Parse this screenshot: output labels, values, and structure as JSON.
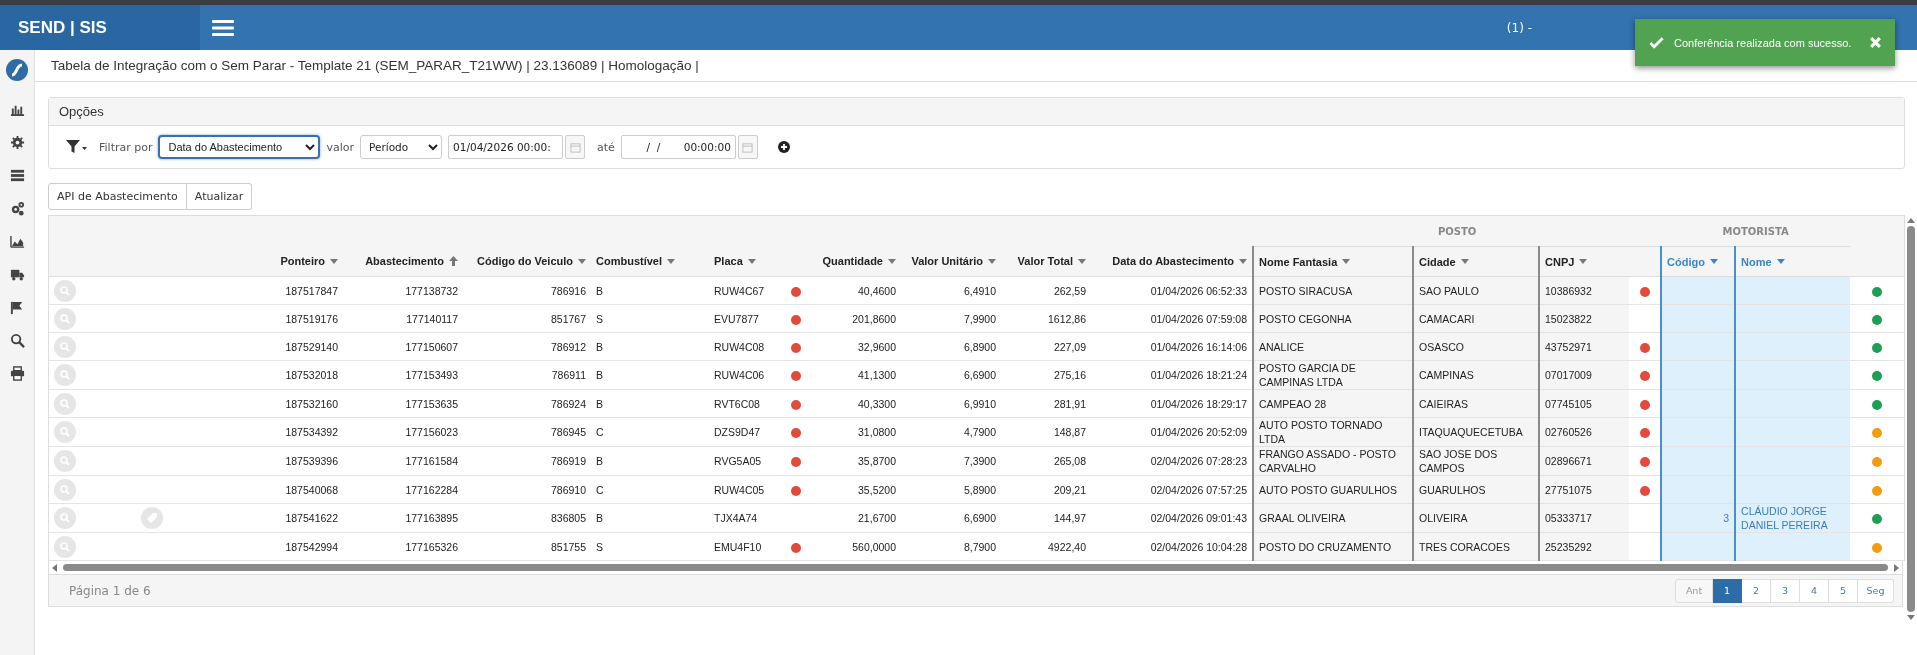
{
  "app": {
    "brand": "SEND | SIS",
    "user_prefix": "(1) -"
  },
  "toast": {
    "message": "Conferência realizada com sucesso."
  },
  "page_title": "Tabela de Integração com o Sem Parar - Template 21 (SEM_PARAR_T21WW) | 23.136089 | Homologação |",
  "options": {
    "title": "Opções",
    "filter_label": "Filtrar por",
    "filter_field": "Data do Abastecimento",
    "value_label": "valor",
    "value_mode": "Período",
    "date_from": "01/04/2026 00:00:",
    "to_label": "até",
    "date_to": " /  /       00:00:00"
  },
  "actions": [
    "API de Abastecimento",
    "Atualizar"
  ],
  "table": {
    "groups": [
      {
        "label": "POSTO"
      },
      {
        "label": "MOTORISTA"
      }
    ],
    "columns": [
      {
        "label": "Ponteiro",
        "sorted": false
      },
      {
        "label": "Abastecimento",
        "sorted": true
      },
      {
        "label": "Código do Veiculo",
        "sorted": false
      },
      {
        "label": "Combustível",
        "sorted": false
      },
      {
        "label": "Placa",
        "sorted": false
      },
      {
        "label": "Quantidade",
        "sorted": false
      },
      {
        "label": "Valor Unitário",
        "sorted": false
      },
      {
        "label": "Valor Total",
        "sorted": false
      },
      {
        "label": "Data do Abastecimento",
        "sorted": false
      },
      {
        "label": "Nome Fantasia",
        "sorted": false
      },
      {
        "label": "Cidade",
        "sorted": false
      },
      {
        "label": "CNPJ",
        "sorted": false
      },
      {
        "label": "Código",
        "sorted": false
      },
      {
        "label": "Nome",
        "sorted": false
      }
    ],
    "rows": [
      {
        "ponteiro": "187517847",
        "abastecimento": "177138732",
        "codigo_veiculo": "786916",
        "combustivel": "B",
        "placa": "RUW4C67",
        "placa_alert": true,
        "quantidade": "40,4600",
        "valor_unitario": "6,4910",
        "valor_total": "262,59",
        "data": "01/04/2026 06:52:33",
        "nome_fantasia": "POSTO SIRACUSA",
        "cidade": "SAO PAULO",
        "cnpj": "10386932",
        "cnpj_alert": true,
        "color": "#1e9e55",
        "has_ticket": false
      },
      {
        "ponteiro": "187519176",
        "abastecimento": "177140117",
        "codigo_veiculo": "851767",
        "combustivel": "S",
        "placa": "EVU7877",
        "placa_alert": true,
        "quantidade": "201,8600",
        "valor_unitario": "7,9900",
        "valor_total": "1612,86",
        "data": "01/04/2026 07:59:08",
        "nome_fantasia": "POSTO CEGONHA",
        "cidade": "CAMACARI",
        "cnpj": "15023822",
        "cnpj_alert": false,
        "color": "#1e9e55",
        "has_ticket": false
      },
      {
        "ponteiro": "187529140",
        "abastecimento": "177150607",
        "codigo_veiculo": "786912",
        "combustivel": "B",
        "placa": "RUW4C08",
        "placa_alert": true,
        "quantidade": "32,9600",
        "valor_unitario": "6,8900",
        "valor_total": "227,09",
        "data": "01/04/2026 16:14:06",
        "nome_fantasia": "ANALICE",
        "cidade": "OSASCO",
        "cnpj": "43752971",
        "cnpj_alert": true,
        "color": "#1e9e55",
        "has_ticket": false
      },
      {
        "ponteiro": "187532018",
        "abastecimento": "177153493",
        "codigo_veiculo": "786911",
        "combustivel": "B",
        "placa": "RUW4C06",
        "placa_alert": true,
        "quantidade": "41,1300",
        "valor_unitario": "6,6900",
        "valor_total": "275,16",
        "data": "01/04/2026 18:21:24",
        "nome_fantasia": "POSTO GARCIA DE CAMPINAS LTDA",
        "cidade": "CAMPINAS",
        "cnpj": "07017009",
        "cnpj_alert": true,
        "color": "#1e9e55",
        "has_ticket": false
      },
      {
        "ponteiro": "187532160",
        "abastecimento": "177153635",
        "codigo_veiculo": "786924",
        "combustivel": "B",
        "placa": "RVT6C08",
        "placa_alert": true,
        "quantidade": "40,3300",
        "valor_unitario": "6,9910",
        "valor_total": "281,91",
        "data": "01/04/2026 18:29:17",
        "nome_fantasia": "CAMPEAO 28",
        "cidade": "CAIEIRAS",
        "cnpj": "07745105",
        "cnpj_alert": true,
        "color": "#1e9e55",
        "has_ticket": false
      },
      {
        "ponteiro": "187534392",
        "abastecimento": "177156023",
        "codigo_veiculo": "786945",
        "combustivel": "C",
        "placa": "DZS9D47",
        "placa_alert": true,
        "quantidade": "31,0800",
        "valor_unitario": "4,7900",
        "valor_total": "148,87",
        "data": "01/04/2026 20:52:09",
        "nome_fantasia": "AUTO POSTO TORNADO LTDA",
        "cidade": "ITAQUAQUECETUBA",
        "cnpj": "02760526",
        "cnpj_alert": true,
        "color": "#f39c12",
        "has_ticket": false
      },
      {
        "ponteiro": "187539396",
        "abastecimento": "177161584",
        "codigo_veiculo": "786919",
        "combustivel": "B",
        "placa": "RVG5A05",
        "placa_alert": true,
        "quantidade": "35,8700",
        "valor_unitario": "7,3900",
        "valor_total": "265,08",
        "data": "02/04/2026 07:28:23",
        "nome_fantasia": "FRANGO ASSADO - POSTO CARVALHO",
        "cidade": "SAO JOSE DOS CAMPOS",
        "cnpj": "02896671",
        "cnpj_alert": true,
        "color": "#f39c12",
        "has_ticket": false
      },
      {
        "ponteiro": "187540068",
        "abastecimento": "177162284",
        "codigo_veiculo": "786910",
        "combustivel": "C",
        "placa": "RUW4C05",
        "placa_alert": true,
        "quantidade": "35,5200",
        "valor_unitario": "5,8900",
        "valor_total": "209,21",
        "data": "02/04/2026 07:57:25",
        "nome_fantasia": "AUTO POSTO GUARULHOS",
        "cidade": "GUARULHOS",
        "cnpj": "27751075",
        "cnpj_alert": true,
        "color": "#f39c12",
        "has_ticket": false
      },
      {
        "ponteiro": "187541622",
        "abastecimento": "177163895",
        "codigo_veiculo": "836805",
        "combustivel": "B",
        "placa": "TJX4A74",
        "placa_alert": false,
        "quantidade": "21,6700",
        "valor_unitario": "6,6900",
        "valor_total": "144,97",
        "data": "02/04/2026 09:01:43",
        "nome_fantasia": "GRAAL OLIVEIRA",
        "cidade": "OLIVEIRA",
        "cnpj": "05333717",
        "cnpj_alert": false,
        "motorista_codigo": "3",
        "motorista_nome": "CLÁUDIO JORGE DANIEL PEREIRA",
        "color": "#1e9e55",
        "has_ticket": true
      },
      {
        "ponteiro": "187542994",
        "abastecimento": "177165326",
        "codigo_veiculo": "851755",
        "combustivel": "S",
        "placa": "EMU4F10",
        "placa_alert": true,
        "quantidade": "560,0000",
        "valor_unitario": "8,7900",
        "valor_total": "4922,40",
        "data": "02/04/2026 10:04:28",
        "nome_fantasia": "POSTO DO CRUZAMENTO",
        "cidade": "TRES CORACOES",
        "cnpj": "25235292",
        "cnpj_alert": false,
        "color": "#f39c12",
        "has_ticket": false
      }
    ]
  },
  "pagination": {
    "summary": "Página 1 de 6",
    "prev": {
      "label": "Ant",
      "disabled": true
    },
    "pages": [
      {
        "label": "1",
        "selected": true
      },
      {
        "label": "2",
        "selected": false
      },
      {
        "label": "3",
        "selected": false
      },
      {
        "label": "4",
        "selected": false
      },
      {
        "label": "5",
        "selected": false
      }
    ],
    "next": {
      "label": "Seg",
      "disabled": false
    }
  }
}
